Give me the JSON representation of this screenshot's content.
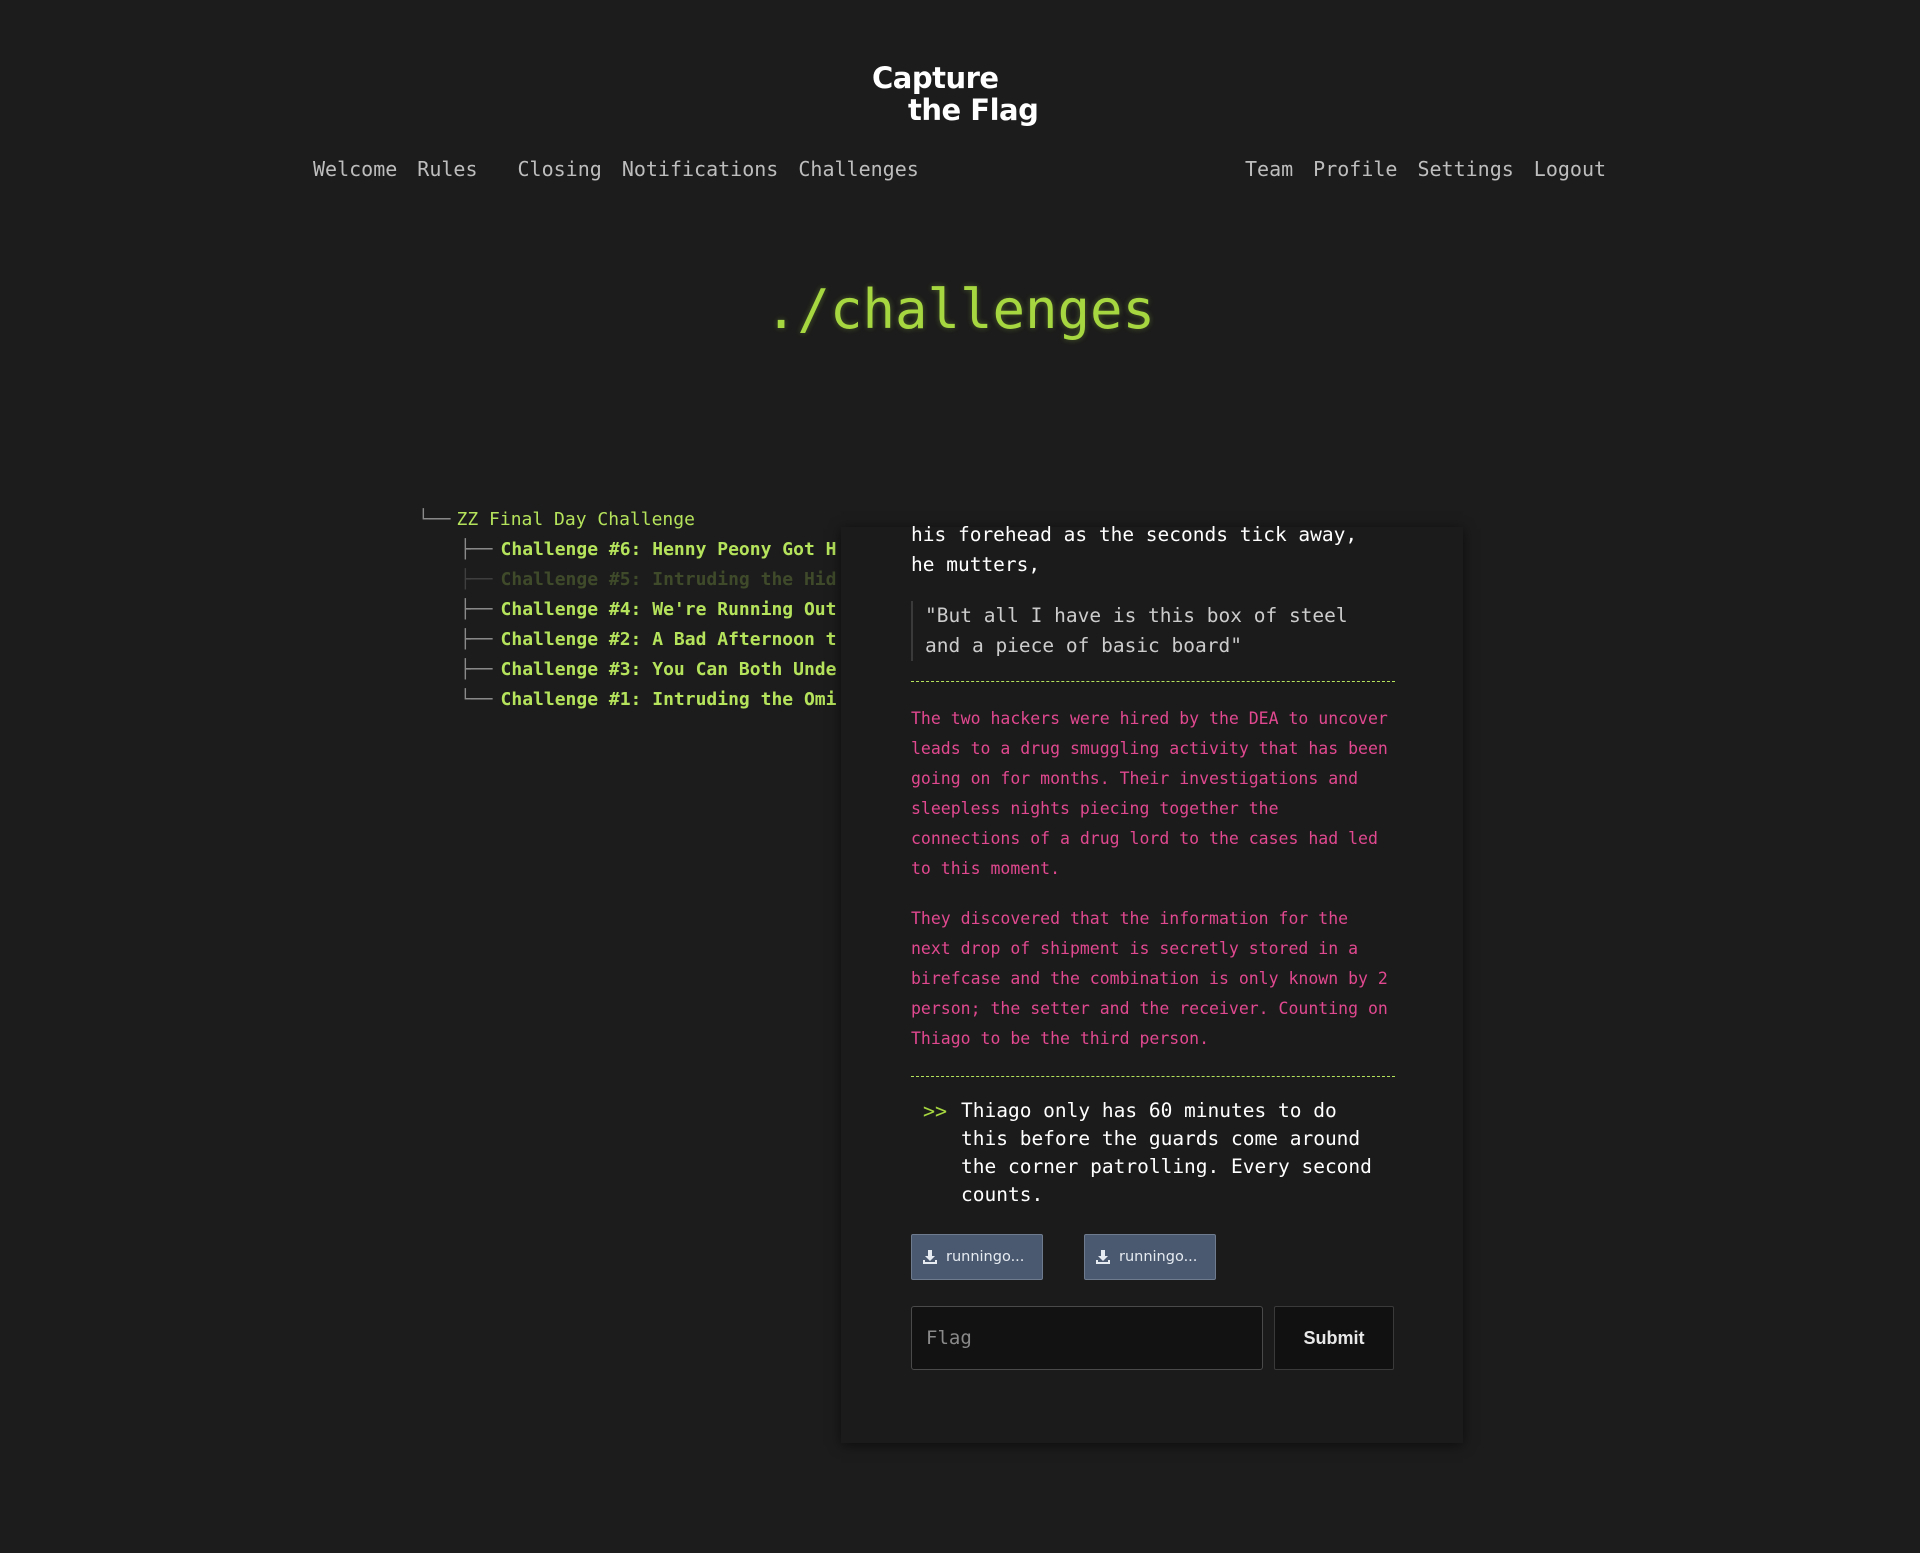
{
  "logo": {
    "line1": "Capture",
    "line2": "the Flag"
  },
  "nav": {
    "left": [
      "Welcome",
      "Rules",
      "Closing",
      "Notifications",
      "Challenges"
    ],
    "right": [
      "Team",
      "Profile",
      "Settings",
      "Logout"
    ]
  },
  "page_title": "./challenges",
  "tree": {
    "root_glyph": "└──",
    "root_label": "ZZ Final Day Challenge",
    "branch_glyph": "├──",
    "last_glyph": "└──",
    "items": [
      {
        "label": "Challenge #6: Henny Peony Got H",
        "state": "active"
      },
      {
        "label": "Challenge #5: Intruding the Hid",
        "state": "dim"
      },
      {
        "label": "Challenge #4: We're Running Out",
        "state": "active"
      },
      {
        "label": "Challenge #2: A Bad Afternoon t",
        "state": "active"
      },
      {
        "label": "Challenge #3: You Can Both Unde",
        "state": "active"
      },
      {
        "label": "Challenge #1: Intruding the Omi",
        "state": "active"
      }
    ]
  },
  "detail": {
    "intro_line1": "his forehead as the seconds tick away,",
    "intro_line2": "he mutters,",
    "quote_line1": "\"But all I have is this box of steel",
    "quote_line2": "and a piece of basic board\"",
    "story_p1": "The two hackers were hired by the DEA to uncover leads to a drug smuggling activity that has been going on for months. Their investigations and sleepless nights piecing together the connections of a drug lord to the cases had led to this moment.",
    "story_p2": "They discovered that the information for the next drop of shipment is secretly stored in a birefcase and the combination is only known by 2 person; the setter and the receiver. Counting on Thiago to be the third person.",
    "callout_marker": ">>",
    "callout_text": "Thiago only has 60 minutes to do this before the guards come around the corner patrolling. Every second counts.",
    "files": [
      "runningo...",
      "runningo..."
    ],
    "flag_placeholder": "Flag",
    "submit_label": "Submit"
  },
  "colors": {
    "background": "#1c1c1c",
    "accent_green": "#a6d640",
    "story_pink": "#e0488f",
    "file_button": "#4a596f"
  }
}
